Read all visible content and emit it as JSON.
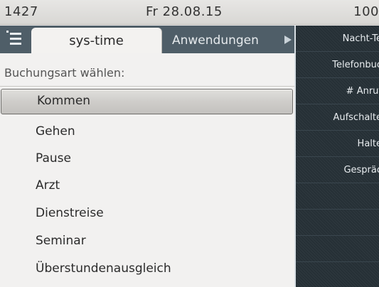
{
  "status_bar": {
    "extension": "1427",
    "date": "Fr 28.08.15",
    "number": "100"
  },
  "tabs": {
    "menu_icon": "menu-list-icon",
    "active": "sys-time",
    "inactive": "Anwendungen",
    "scroll_icon": "triangle-right-icon"
  },
  "content": {
    "prompt": "Buchungsart wählen:",
    "items": [
      "Kommen",
      "Gehen",
      "Pause",
      "Arzt",
      "Dienstreise",
      "Seminar",
      "Überstundenausgleich"
    ],
    "selected_index": 0
  },
  "softkeys": [
    "Nacht-Te",
    "Telefonbuc",
    "# Anruf",
    "Aufschalte",
    "Halte",
    "Gespräc",
    "",
    "",
    ""
  ],
  "colors": {
    "tab_bar": "#4f5e68",
    "softkey_panel": "#263036",
    "background": "#f2f1f0"
  }
}
